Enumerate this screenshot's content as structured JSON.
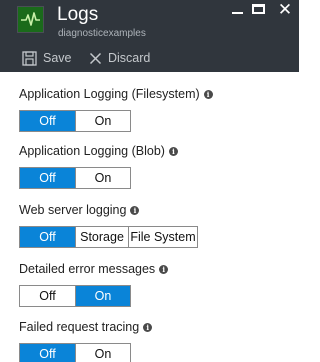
{
  "header": {
    "title": "Logs",
    "subtitle": "diagnosticexamples",
    "logo_icon": "activity-pulse-icon",
    "background": "#30363d"
  },
  "window_controls": {
    "minimize_icon": "minimize-icon",
    "maximize_icon": "maximize-icon",
    "close_icon": "close-icon",
    "close_glyph": "✕"
  },
  "toolbar": {
    "save_label": "Save",
    "discard_label": "Discard"
  },
  "accent_color": "#0a84d8",
  "settings": [
    {
      "label": "Application Logging (Filesystem)",
      "options": [
        "Off",
        "On"
      ],
      "selected": "Off"
    },
    {
      "label": "Application Logging (Blob)",
      "options": [
        "Off",
        "On"
      ],
      "selected": "Off"
    },
    {
      "label": "Web server logging",
      "options": [
        "Off",
        "Storage",
        "File System"
      ],
      "selected": "Off"
    },
    {
      "label": "Detailed error messages",
      "options": [
        "Off",
        "On"
      ],
      "selected": "On"
    },
    {
      "label": "Failed request tracing",
      "options": [
        "Off",
        "On"
      ],
      "selected": "Off"
    }
  ]
}
